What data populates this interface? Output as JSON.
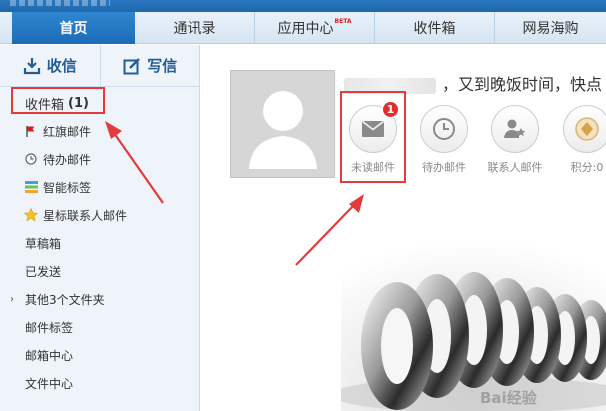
{
  "tabs": [
    {
      "label": "首页",
      "active": true
    },
    {
      "label": "通讯录",
      "active": false
    },
    {
      "label": "应用中心",
      "active": false,
      "badge": "BETA"
    },
    {
      "label": "收件箱",
      "active": false
    },
    {
      "label": "网易海购",
      "active": false
    }
  ],
  "sidebar": {
    "receive_label": "收信",
    "compose_label": "写信",
    "inbox_label": "收件箱",
    "inbox_count": "(1)",
    "items": [
      {
        "label": "红旗邮件",
        "icon": "red-flag-icon"
      },
      {
        "label": "待办邮件",
        "icon": "clock-icon"
      },
      {
        "label": "智能标签",
        "icon": "tag-stripes-icon"
      },
      {
        "label": "星标联系人邮件",
        "icon": "star-icon"
      },
      {
        "label": "草稿箱"
      },
      {
        "label": "已发送"
      },
      {
        "label": "其他3个文件夹",
        "icon": "chevron-right-icon"
      },
      {
        "label": "邮件标签"
      },
      {
        "label": "邮箱中心"
      },
      {
        "label": "文件中心"
      }
    ]
  },
  "main": {
    "greeting": "，又到晚饭时间，快点",
    "quick_links": [
      {
        "label": "未读邮件",
        "icon": "envelope-icon",
        "badge": "1"
      },
      {
        "label": "待办邮件",
        "icon": "clock-icon"
      },
      {
        "label": "联系人邮件",
        "icon": "contact-star-icon"
      },
      {
        "label": "积分:0",
        "icon": "coin-icon"
      }
    ]
  },
  "watermark": "Bai经验",
  "colors": {
    "accent": "#1c6bb5",
    "highlight": "#e53a3a",
    "badge": "#e12d2d"
  }
}
